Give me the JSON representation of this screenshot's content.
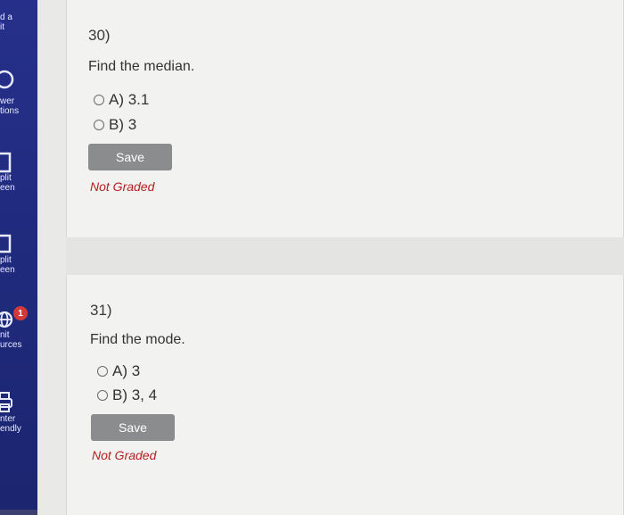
{
  "sidebar": {
    "items": [
      {
        "line1": "d a",
        "line2": "it"
      },
      {
        "line1": "wer",
        "line2": "tions"
      },
      {
        "line1": "plit",
        "line2": "een"
      },
      {
        "line1": "plit",
        "line2": "een"
      },
      {
        "line1": "nit",
        "line2": "urces",
        "badge": "1"
      },
      {
        "line1": "nter",
        "line2": "endly"
      }
    ]
  },
  "questions": [
    {
      "number": "30)",
      "text": "Find the median.",
      "options": [
        "A) 3.1",
        "B) 3"
      ],
      "save_label": "Save",
      "status": "Not Graded"
    },
    {
      "number": "31)",
      "text": "Find the mode.",
      "options": [
        "A) 3",
        "B) 3, 4"
      ],
      "save_label": "Save",
      "status": "Not Graded"
    }
  ],
  "colors": {
    "sidebar": "#26308a",
    "save_button": "#8a8c8e",
    "status_text": "#b22222",
    "badge": "#d23a3a"
  }
}
